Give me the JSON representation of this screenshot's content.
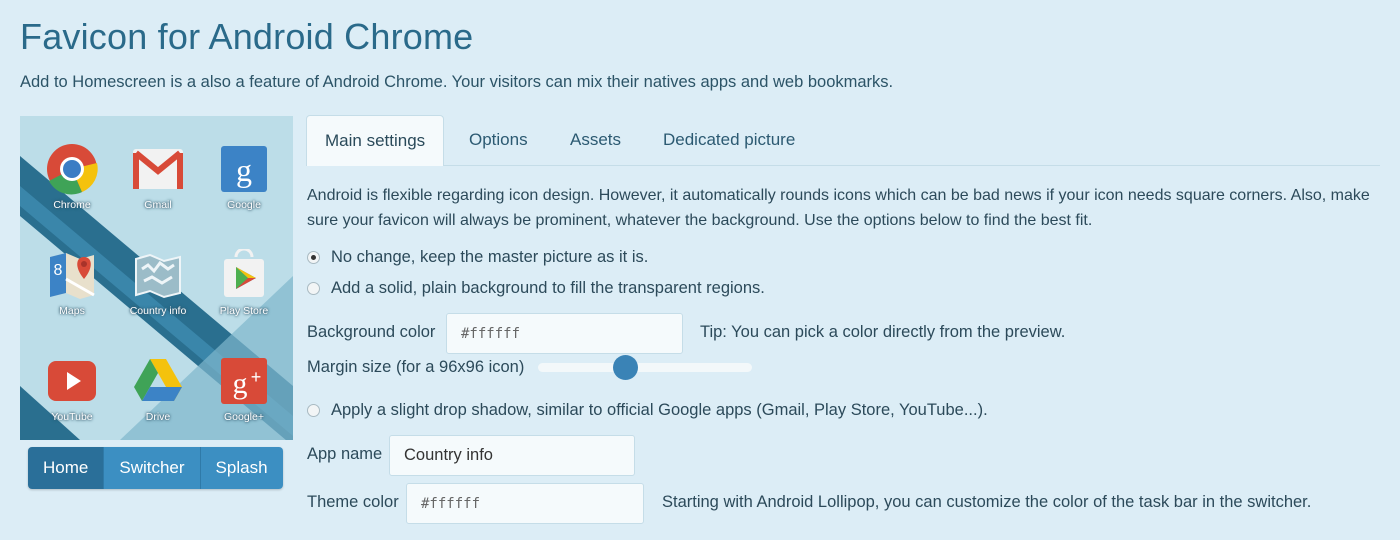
{
  "header": {
    "title": "Favicon for Android Chrome",
    "subtitle": "Add to Homescreen is a also a feature of Android Chrome. Your visitors can mix their natives apps and web bookmarks."
  },
  "preview": {
    "apps": [
      {
        "label": "Chrome",
        "icon": "chrome-icon"
      },
      {
        "label": "Gmail",
        "icon": "gmail-icon"
      },
      {
        "label": "Google",
        "icon": "google-icon"
      },
      {
        "label": "Maps",
        "icon": "maps-icon"
      },
      {
        "label": "Country info",
        "icon": "country-info-icon"
      },
      {
        "label": "Play Store",
        "icon": "play-store-icon"
      },
      {
        "label": "YouTube",
        "icon": "youtube-icon"
      },
      {
        "label": "Drive",
        "icon": "drive-icon"
      },
      {
        "label": "Google+",
        "icon": "google-plus-icon"
      }
    ],
    "modes": {
      "home": "Home",
      "switcher": "Switcher",
      "splash": "Splash",
      "selected": "Home"
    }
  },
  "tabs": {
    "main": "Main settings",
    "options": "Options",
    "assets": "Assets",
    "dedicated": "Dedicated picture",
    "selected": "Main settings"
  },
  "settings": {
    "description": "Android is flexible regarding icon design. However, it automatically rounds icons which can be bad news if your icon needs square corners. Also, make sure your favicon will always be prominent, whatever the background. Use the options below to find the best fit.",
    "option_no_change": "No change, keep the master picture as it is.",
    "option_solid_bg": "Add a solid, plain background to fill the transparent regions.",
    "bg_color_label": "Background color",
    "bg_color_value": "#ffffff",
    "bg_color_tip": "Tip: You can pick a color directly from the preview.",
    "margin_label": "Margin size (for a 96x96 icon)",
    "margin_fraction": 0.41,
    "shadow_label": "Apply a slight drop shadow, similar to official Google apps (Gmail, Play Store, YouTube...).",
    "app_name_label": "App name",
    "app_name_value": "Country info",
    "theme_color_label": "Theme color",
    "theme_color_value": "#ffffff",
    "theme_color_tip": "Starting with Android Lollipop, you can customize the color of the task bar in the switcher."
  },
  "colors": {
    "page_bg": "#dcedf6",
    "accent": "#3c8fc2",
    "accent_active": "#2a6f99",
    "title": "#2a6a8a"
  }
}
